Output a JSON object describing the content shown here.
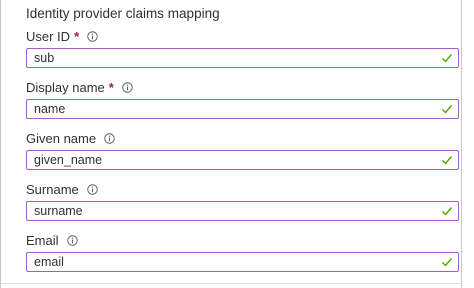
{
  "section": {
    "title": "Identity provider claims mapping"
  },
  "fields": [
    {
      "label": "User ID",
      "required": true,
      "required_mark": "*",
      "value": "sub"
    },
    {
      "label": "Display name",
      "required": true,
      "required_mark": "*",
      "value": "name"
    },
    {
      "label": "Given name",
      "required": false,
      "required_mark": "",
      "value": "given_name"
    },
    {
      "label": "Surname",
      "required": false,
      "required_mark": "",
      "value": "surname"
    },
    {
      "label": "Email",
      "required": false,
      "required_mark": "",
      "value": "email"
    }
  ],
  "colors": {
    "input_border": "#a55ec4",
    "required": "#a4262c",
    "valid_check": "#57a300",
    "info_icon": "#605e5c"
  },
  "icons": {
    "info": "info-icon",
    "valid": "checkmark-icon"
  }
}
